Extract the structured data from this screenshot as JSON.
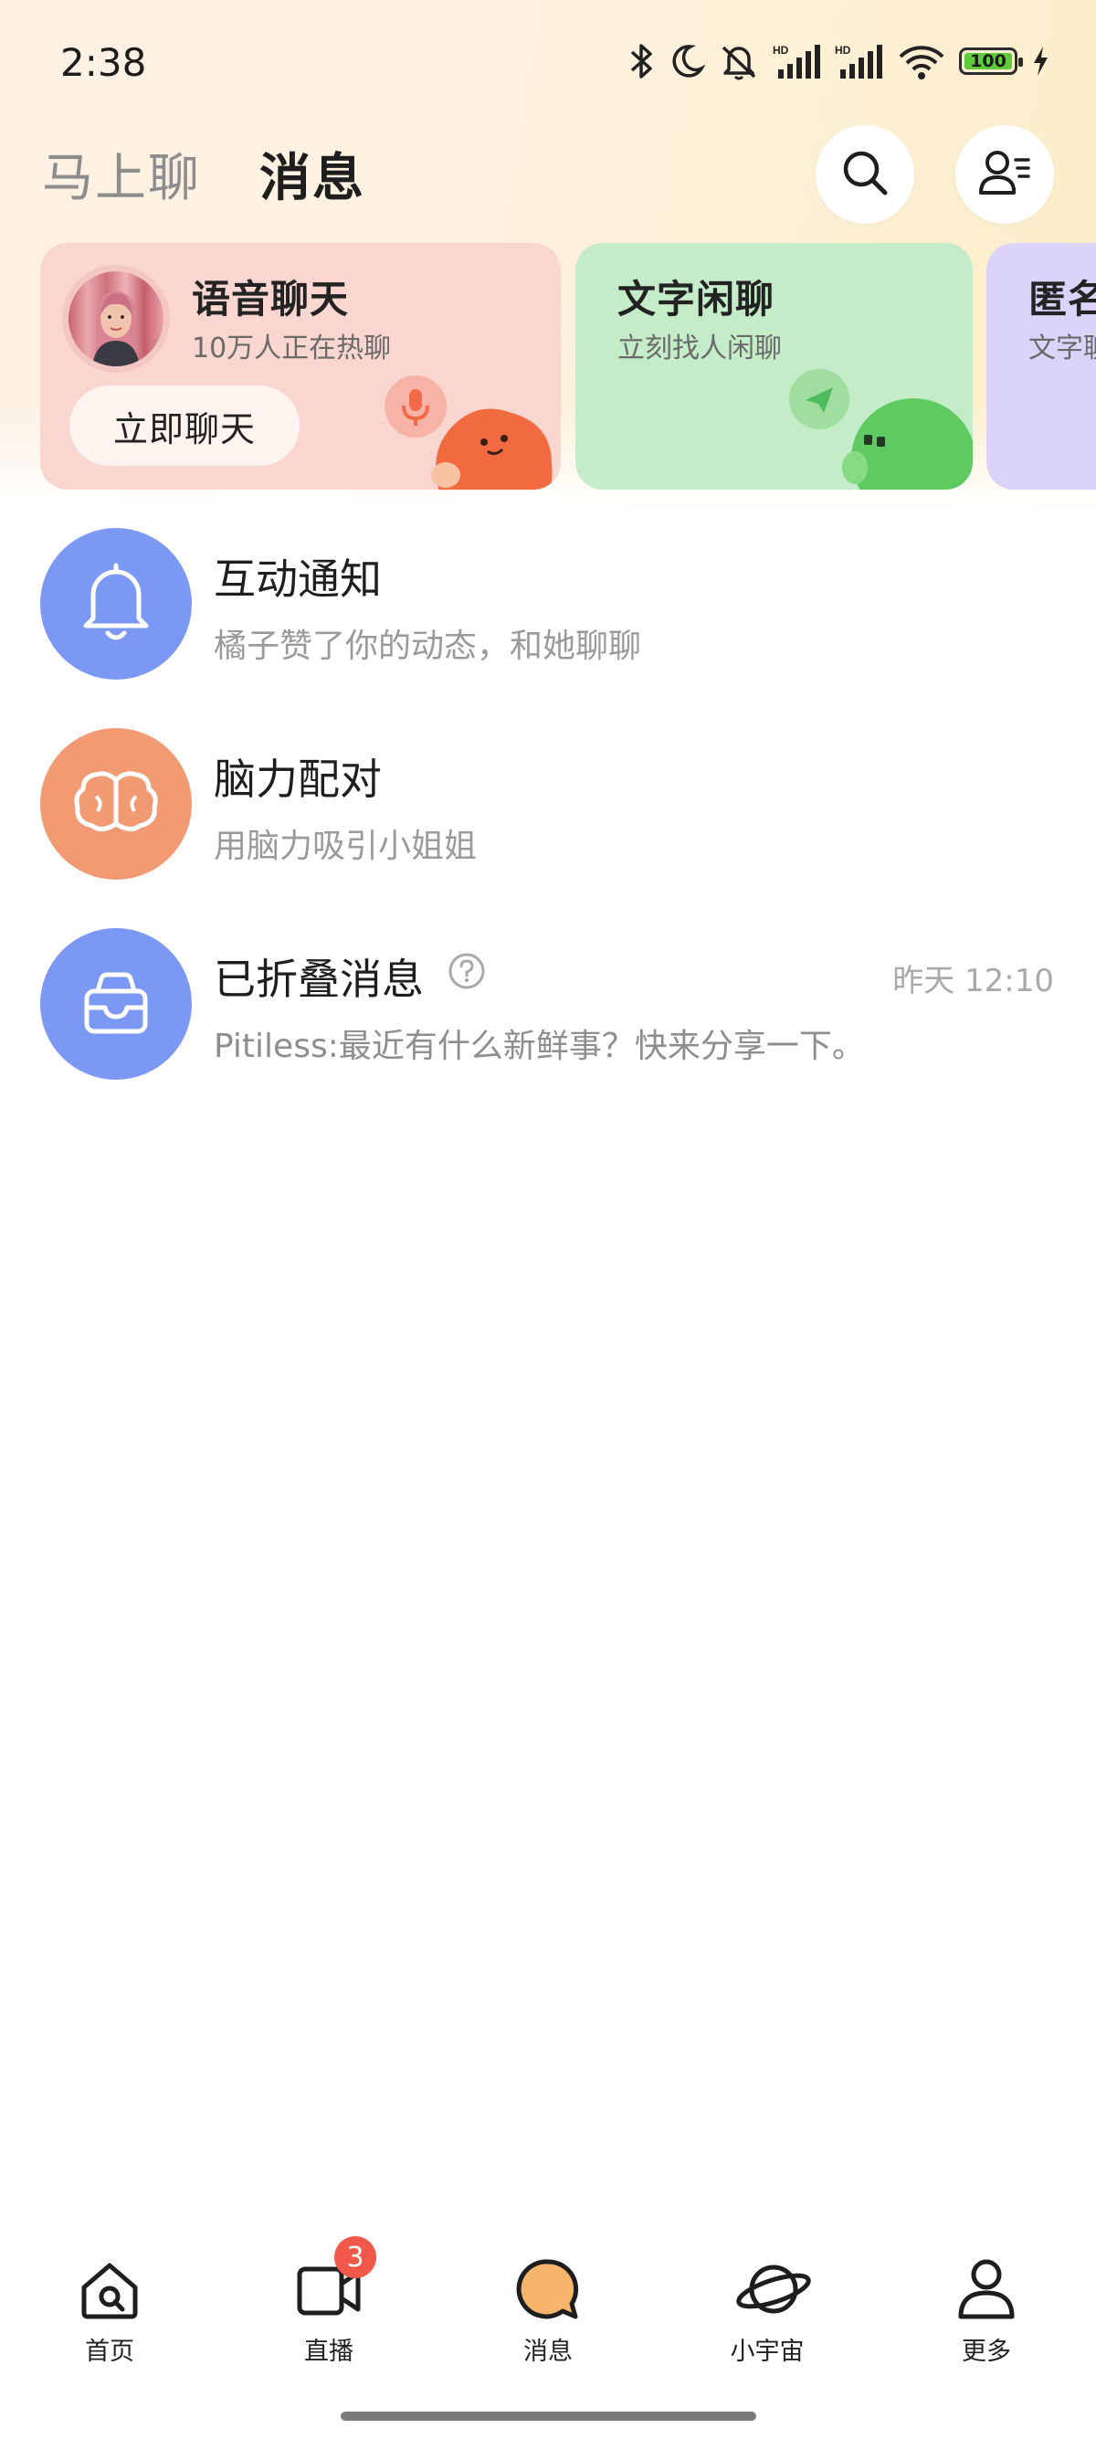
{
  "status_bar": {
    "time": "2:38",
    "battery": "100",
    "icons": [
      "bluetooth-icon",
      "moon-icon",
      "bell-muted-icon",
      "signal-hd-1-icon",
      "signal-hd-2-icon",
      "wifi-icon",
      "battery-icon",
      "charging-icon"
    ]
  },
  "header": {
    "tabs": [
      {
        "label": "马上聊",
        "active": false
      },
      {
        "label": "消息",
        "active": true
      }
    ],
    "search_icon": "search-icon",
    "contacts_icon": "contacts-icon"
  },
  "cards": [
    {
      "title": "语音聊天",
      "subtitle": "10万人正在热聊",
      "button": "立即聊天",
      "color": "#f9d6d0"
    },
    {
      "title": "文字闲聊",
      "subtitle": "立刻找人闲聊",
      "color": "#c5ecc8"
    },
    {
      "title": "匿名",
      "subtitle": "文字聊",
      "color": "#dcd3fb"
    }
  ],
  "messages": [
    {
      "name": "互动通知",
      "desc": "橘子赞了你的动态，和她聊聊",
      "icon": "bell-icon",
      "color": "#7b98f4"
    },
    {
      "name": "脑力配对",
      "desc": "用脑力吸引小姐姐",
      "icon": "brain-icon",
      "color": "#f29b72"
    },
    {
      "name": "已折叠消息",
      "desc": "Pitiless:最近有什么新鲜事？快来分享一下。",
      "time": "昨天 12:10",
      "icon": "inbox-icon",
      "color": "#7b98f4"
    }
  ],
  "bottom_nav": [
    {
      "label": "首页",
      "icon": "home-icon"
    },
    {
      "label": "直播",
      "icon": "video-icon",
      "badge": "3"
    },
    {
      "label": "消息",
      "icon": "message-icon",
      "active": true
    },
    {
      "label": "小宇宙",
      "icon": "planet-icon"
    },
    {
      "label": "更多",
      "icon": "person-icon"
    }
  ]
}
